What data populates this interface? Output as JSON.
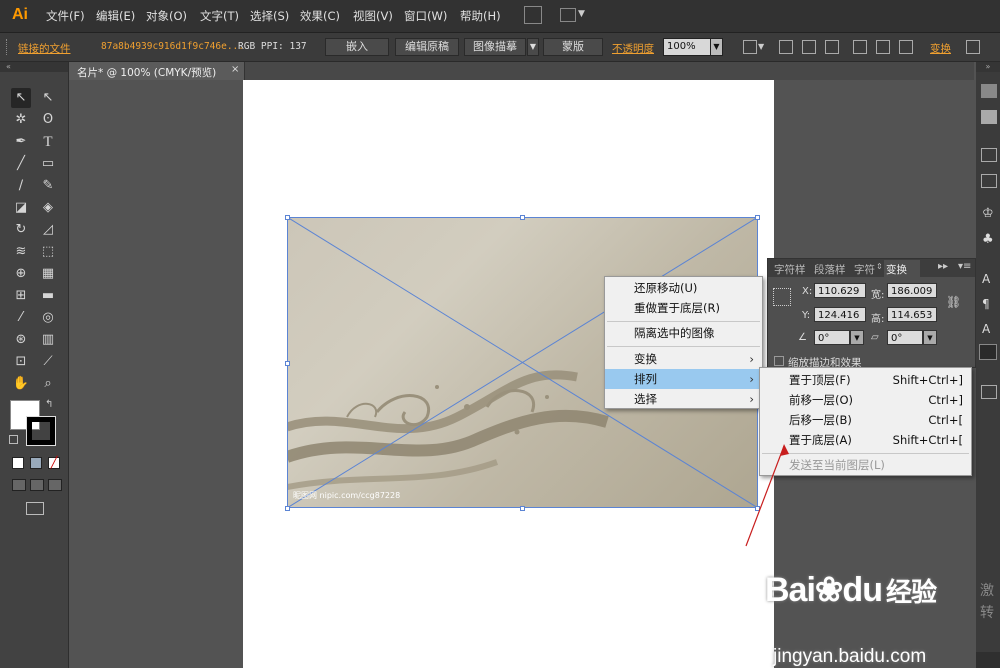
{
  "menubar": {
    "logo": "Ai",
    "items": [
      "文件(F)",
      "编辑(E)",
      "对象(O)",
      "文字(T)",
      "选择(S)",
      "效果(C)",
      "视图(V)",
      "窗口(W)",
      "帮助(H)"
    ]
  },
  "controlbar": {
    "linked_file": "链接的文件",
    "file_name": "87a8b4939c916d1f9c746e...",
    "color_info": "RGB  PPI: 137",
    "embed": "嵌入",
    "edit_original": "编辑原稿",
    "image_trace": "图像描摹",
    "mask": "蒙版",
    "opacity_label": "不透明度",
    "opacity_value": "100%",
    "transform": "变换"
  },
  "document": {
    "tab_title": "名片* @ 100% (CMYK/预览)",
    "image_caption": "昵图网 nipic.com/ccg87228"
  },
  "transform_panel": {
    "tabs": [
      "字符样",
      "段落样",
      "字符",
      "变换"
    ],
    "x_label": "X:",
    "x_value": "110.629",
    "y_label": "Y:",
    "y_value": "124.416",
    "w_label": "宽:",
    "w_value": "186.009",
    "h_label": "高:",
    "h_value": "114.653",
    "angle_value": "0°",
    "shear_value": "0°",
    "scale_strokes": "缩放描边和效果"
  },
  "context_menu": {
    "items": [
      "还原移动(U)",
      "重做置于底层(R)",
      "隔离选中的图像",
      "变换",
      "排列",
      "选择"
    ]
  },
  "arrange_submenu": {
    "items": [
      {
        "label": "置于顶层(F)",
        "shortcut": "Shift+Ctrl+]"
      },
      {
        "label": "前移一层(O)",
        "shortcut": "Ctrl+]"
      },
      {
        "label": "后移一层(B)",
        "shortcut": "Ctrl+["
      },
      {
        "label": "置于底层(A)",
        "shortcut": "Shift+Ctrl+["
      },
      {
        "label": "发送至当前图层(L)",
        "shortcut": ""
      }
    ]
  },
  "right_strip": {
    "partial_text_1": "激",
    "partial_text_2": "转"
  },
  "watermark": {
    "brand": "Bai",
    "brand2": "du",
    "brand_cn": "经验",
    "url": "jingyan.baidu.com"
  },
  "colors": {
    "ai_orange": "#ff9a00",
    "selection_blue": "#5b84d4",
    "menu_highlight": "#99c9ef",
    "arrow_red": "#c81e1e"
  }
}
